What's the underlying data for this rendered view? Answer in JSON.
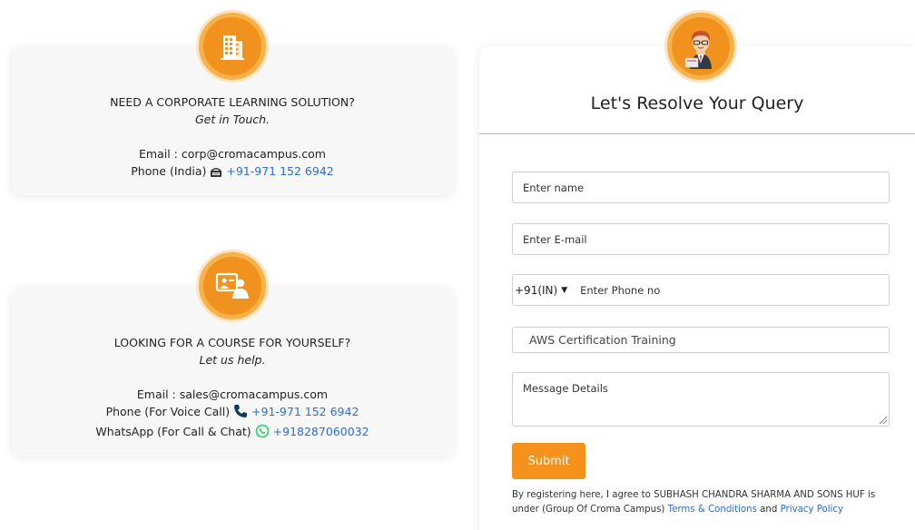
{
  "corporate": {
    "heading": "NEED A CORPORATE LEARNING SOLUTION?",
    "sub": "Get in Touch.",
    "email_label": "Email : ",
    "email": "corp@cromacampus.com",
    "phone_label": "Phone (India) ",
    "phone": "+91-971 152 6942"
  },
  "personal": {
    "heading": "LOOKING FOR A COURSE FOR YOURSELF?",
    "sub": "Let us help.",
    "email_label": "Email : ",
    "email": "sales@cromacampus.com",
    "phone_label": "Phone (For Voice Call) ",
    "phone": "+91-971 152 6942",
    "whatsapp_label": "WhatsApp (For Call & Chat) ",
    "whatsapp": "+918287060032"
  },
  "form": {
    "title": "Let's Resolve Your Query",
    "name_placeholder": "Enter name",
    "email_placeholder": "Enter E-mail",
    "country_code": "+91(IN)",
    "phone_placeholder": "Enter Phone no",
    "course": "AWS Certification Training",
    "message_placeholder": "Message Details",
    "submit_label": "Submit",
    "terms_prefix": "By registering here, I agree to SUBHASH CHANDRA SHARMA AND SONS HUF is under (Group Of Croma Campus) ",
    "terms_link": "Terms & Conditions",
    "terms_and": " and ",
    "privacy_link": "Privacy Policy"
  },
  "colors": {
    "accent": "#f5921c",
    "link": "#2a6dd6",
    "whatsapp": "#25d366"
  },
  "icons": [
    "building-icon",
    "presentation-icon",
    "support-agent-icon",
    "telephone-icon",
    "phone-icon",
    "whatsapp-icon"
  ]
}
